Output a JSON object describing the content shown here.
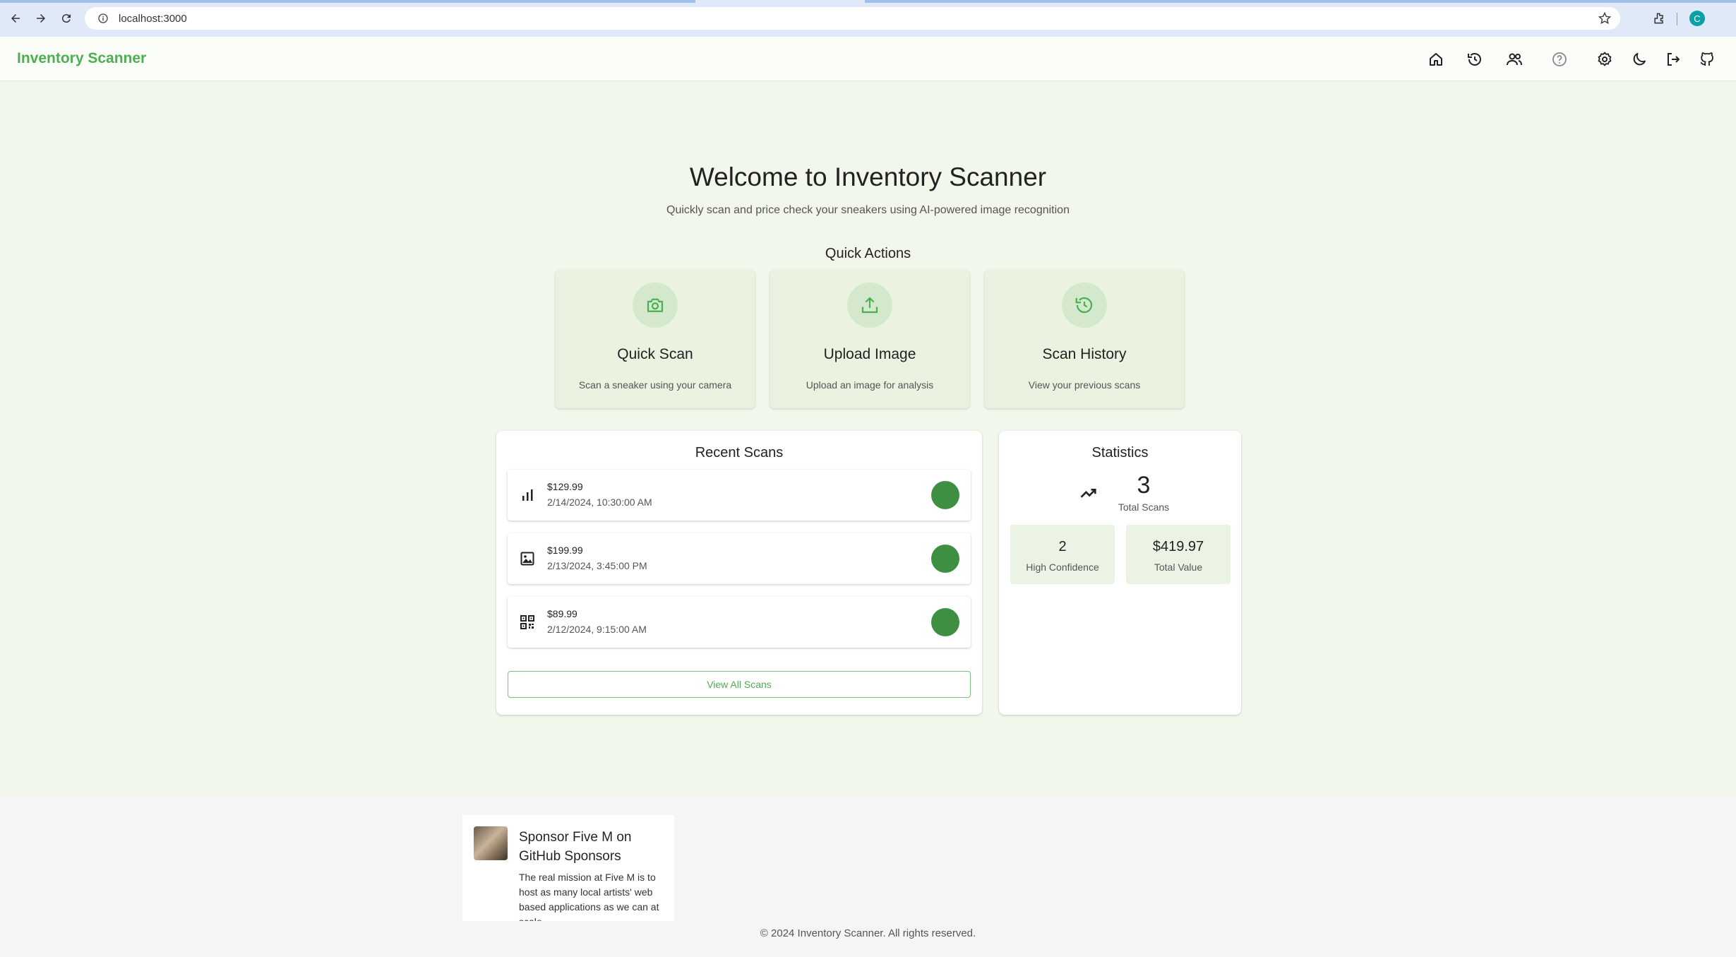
{
  "browser": {
    "url": "localhost:3000",
    "profile_initial": "C"
  },
  "header": {
    "brand": "Inventory Scanner",
    "icons": [
      "home-icon",
      "history-icon",
      "people-icon",
      "help-icon",
      "settings-icon",
      "dark-mode-icon",
      "logout-icon",
      "github-icon"
    ]
  },
  "hero": {
    "title": "Welcome to Inventory Scanner",
    "subtitle": "Quickly scan and price check your sneakers using AI-powered image recognition"
  },
  "quick_actions": {
    "title": "Quick Actions",
    "items": [
      {
        "label": "Quick Scan",
        "description": "Scan a sneaker using your camera",
        "icon": "camera-icon"
      },
      {
        "label": "Upload Image",
        "description": "Upload an image for analysis",
        "icon": "upload-icon"
      },
      {
        "label": "Scan History",
        "description": "View your previous scans",
        "icon": "history-icon"
      }
    ]
  },
  "recent_scans": {
    "title": "Recent Scans",
    "items": [
      {
        "price": "$129.99",
        "date": "2/14/2024, 10:30:00 AM",
        "icon": "bar-chart-icon"
      },
      {
        "price": "$199.99",
        "date": "2/13/2024, 3:45:00 PM",
        "icon": "image-icon"
      },
      {
        "price": "$89.99",
        "date": "2/12/2024, 9:15:00 AM",
        "icon": "qr-code-icon"
      }
    ],
    "view_all_label": "View All Scans"
  },
  "statistics": {
    "title": "Statistics",
    "total_scans": "3",
    "total_scans_label": "Total Scans",
    "high_confidence": "2",
    "high_confidence_label": "High Confidence",
    "total_value": "$419.97",
    "total_value_label": "Total Value"
  },
  "footer": {
    "sponsor_title": "Sponsor Five M on GitHub Sponsors",
    "sponsor_description": "The real mission at Five M is to host as many local artists' web based applications as we can at scale.",
    "copyright": "© 2024 Inventory Scanner. All rights reserved."
  },
  "colors": {
    "brand": "#4caf50",
    "page_bg": "#f1f7ea",
    "status_dot": "#3f8f43"
  }
}
